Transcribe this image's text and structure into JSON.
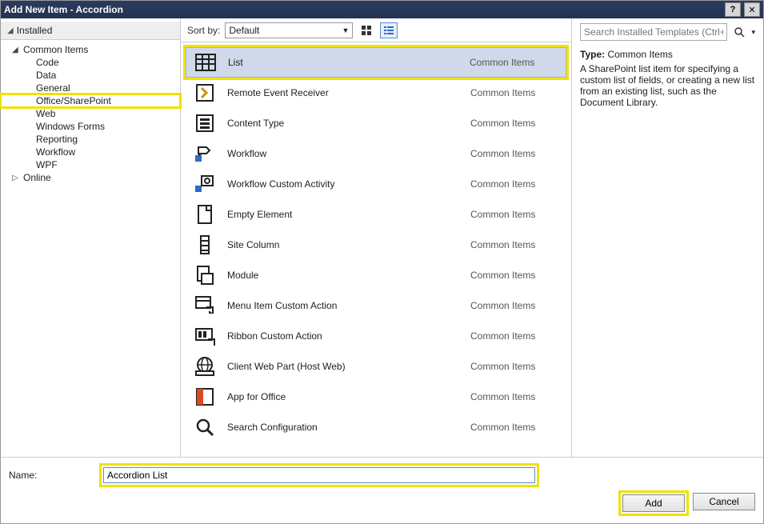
{
  "title": "Add New Item - Accordion",
  "tree": {
    "rootLabel": "Installed",
    "commonItems": "Common Items",
    "children": [
      "Code",
      "Data",
      "General",
      "Office/SharePoint",
      "Web",
      "Windows Forms",
      "Reporting",
      "Workflow",
      "WPF"
    ],
    "online": "Online"
  },
  "sort": {
    "label": "Sort by:",
    "value": "Default"
  },
  "templates": [
    {
      "name": "List",
      "cat": "Common Items"
    },
    {
      "name": "Remote Event Receiver",
      "cat": "Common Items"
    },
    {
      "name": "Content Type",
      "cat": "Common Items"
    },
    {
      "name": "Workflow",
      "cat": "Common Items"
    },
    {
      "name": "Workflow Custom Activity",
      "cat": "Common Items"
    },
    {
      "name": "Empty Element",
      "cat": "Common Items"
    },
    {
      "name": "Site Column",
      "cat": "Common Items"
    },
    {
      "name": "Module",
      "cat": "Common Items"
    },
    {
      "name": "Menu Item Custom Action",
      "cat": "Common Items"
    },
    {
      "name": "Ribbon Custom Action",
      "cat": "Common Items"
    },
    {
      "name": "Client Web Part (Host Web)",
      "cat": "Common Items"
    },
    {
      "name": "App for Office",
      "cat": "Common Items"
    },
    {
      "name": "Search Configuration",
      "cat": "Common Items"
    }
  ],
  "search": {
    "placeholder": "Search Installed Templates (Ctrl+E)"
  },
  "detail": {
    "typeLabel": "Type:",
    "typeValue": "Common Items",
    "description": "A SharePoint list item for specifying a custom list of fields, or creating a new list from an existing list, such as the Document Library."
  },
  "name": {
    "label": "Name:",
    "value": "Accordion List"
  },
  "buttons": {
    "add": "Add",
    "cancel": "Cancel"
  }
}
